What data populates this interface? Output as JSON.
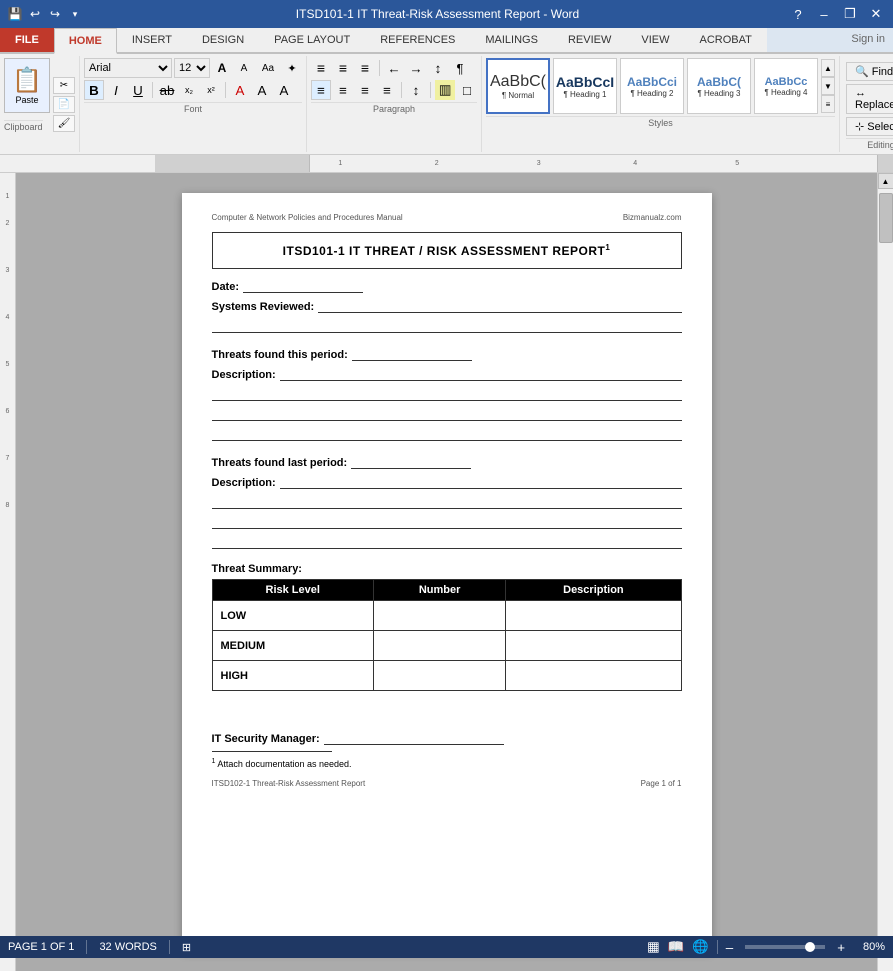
{
  "titleBar": {
    "title": "ITSD101-1 IT Threat-Risk Assessment Report - Word",
    "appName": "Word",
    "helpBtn": "?",
    "minimize": "–",
    "restore": "❐",
    "close": "✕"
  },
  "quickAccess": {
    "save": "💾",
    "undo": "↩",
    "redo": "↪",
    "dropdown": "▾"
  },
  "ribbonTabs": [
    {
      "id": "file",
      "label": "FILE",
      "isFile": true
    },
    {
      "id": "home",
      "label": "HOME",
      "active": true
    },
    {
      "id": "insert",
      "label": "INSERT"
    },
    {
      "id": "design",
      "label": "DESIGN"
    },
    {
      "id": "pageLayout",
      "label": "PAGE LAYOUT"
    },
    {
      "id": "references",
      "label": "REFERENCES"
    },
    {
      "id": "mailings",
      "label": "MAILINGS"
    },
    {
      "id": "review",
      "label": "REVIEW"
    },
    {
      "id": "view",
      "label": "VIEW"
    },
    {
      "id": "acrobat",
      "label": "ACROBAT"
    }
  ],
  "ribbon": {
    "clipboard": {
      "label": "Clipboard",
      "pasteLabel": "Paste",
      "cutLabel": "Cut",
      "copyLabel": "Copy",
      "formatPainterLabel": "Format Painter"
    },
    "font": {
      "label": "Font",
      "fontName": "Arial",
      "fontSize": "12",
      "boldLabel": "B",
      "italicLabel": "I",
      "underlineLabel": "U",
      "strikethroughLabel": "abc",
      "subscriptLabel": "x₂",
      "superscriptLabel": "x²",
      "fontColorLabel": "A",
      "highlightLabel": "A",
      "clearFormatLabel": "A",
      "growFontLabel": "A",
      "shrinkFontLabel": "A",
      "changeCaseLabel": "Aa"
    },
    "paragraph": {
      "label": "Paragraph",
      "bullets": "≡",
      "numbering": "≡",
      "multiLevel": "≡",
      "decreaseIndent": "←",
      "increaseIndent": "→",
      "sort": "↕",
      "showHide": "¶",
      "alignLeft": "≡",
      "alignCenter": "≡",
      "alignRight": "≡",
      "justify": "≡",
      "lineSpacing": "↕",
      "shading": "▥",
      "borders": "□"
    },
    "styles": {
      "label": "Styles",
      "items": [
        {
          "id": "normal",
          "preview": "AaBbCc",
          "label": "¶ Normal"
        },
        {
          "id": "h1",
          "preview": "AaBbCcI",
          "label": "¶ Heading 1"
        },
        {
          "id": "h2",
          "preview": "AaBbCci",
          "label": "¶ Heading 2"
        },
        {
          "id": "h3",
          "preview": "AaBbCc",
          "label": "¶ Heading 3"
        },
        {
          "id": "h4",
          "preview": "AaBbCc",
          "label": "¶ Heading 4"
        }
      ]
    },
    "editing": {
      "label": "Editing",
      "findLabel": "▶ Find",
      "replaceLabel": "↔ Replace",
      "selectLabel": "↓ Select"
    }
  },
  "document": {
    "header": {
      "left": "Computer & Network Policies and Procedures Manual",
      "right": "Bizmanualz.com"
    },
    "title": "ITSD101-1  IT THREAT / RISK ASSESSMENT REPORT",
    "titleSup": "1",
    "fields": {
      "dateLabel": "Date:",
      "systemsReviewedLabel": "Systems Reviewed:",
      "threatsFoundLabel": "Threats found this period:",
      "descriptionLabel": "Description:",
      "threatsLastLabel": "Threats found last period:",
      "threatSummaryLabel": "Threat Summary:",
      "itSecurityLabel": "IT Security Manager:"
    },
    "table": {
      "headers": [
        "Risk Level",
        "Number",
        "Description"
      ],
      "rows": [
        {
          "risk": "LOW",
          "number": "",
          "description": ""
        },
        {
          "risk": "MEDIUM",
          "number": "",
          "description": ""
        },
        {
          "risk": "HIGH",
          "number": "",
          "description": ""
        }
      ]
    },
    "footnote": "Attach documentation as needed.",
    "footnoteSup": "1",
    "footer": {
      "left": "ITSD102-1 Threat-Risk Assessment Report",
      "right": "Page 1 of 1"
    }
  },
  "statusBar": {
    "page": "PAGE 1 OF 1",
    "words": "32 WORDS",
    "viewIcon": "⊞",
    "zoom": "80%"
  }
}
